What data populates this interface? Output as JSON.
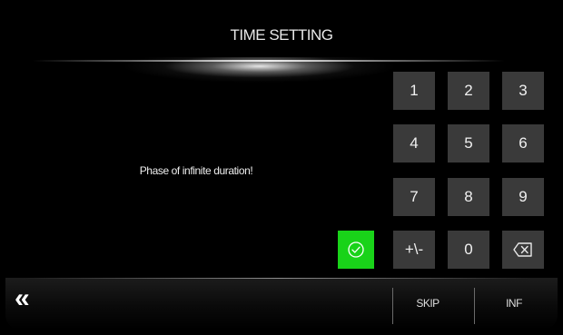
{
  "header": {
    "title": "TIME SETTING"
  },
  "message": "Phase of infinite duration!",
  "keypad": {
    "k1": "1",
    "k2": "2",
    "k3": "3",
    "k4": "4",
    "k5": "5",
    "k6": "6",
    "k7": "7",
    "k8": "8",
    "k9": "9",
    "sign": "+\\-",
    "k0": "0",
    "backspace_icon": "backspace-icon"
  },
  "confirm": {
    "icon": "check-circle-icon",
    "color": "#19d319"
  },
  "footer": {
    "back_icon": "double-chevron-left-icon",
    "back_glyph": "«",
    "skip_label": "SKIP",
    "inf_label": "INF"
  }
}
